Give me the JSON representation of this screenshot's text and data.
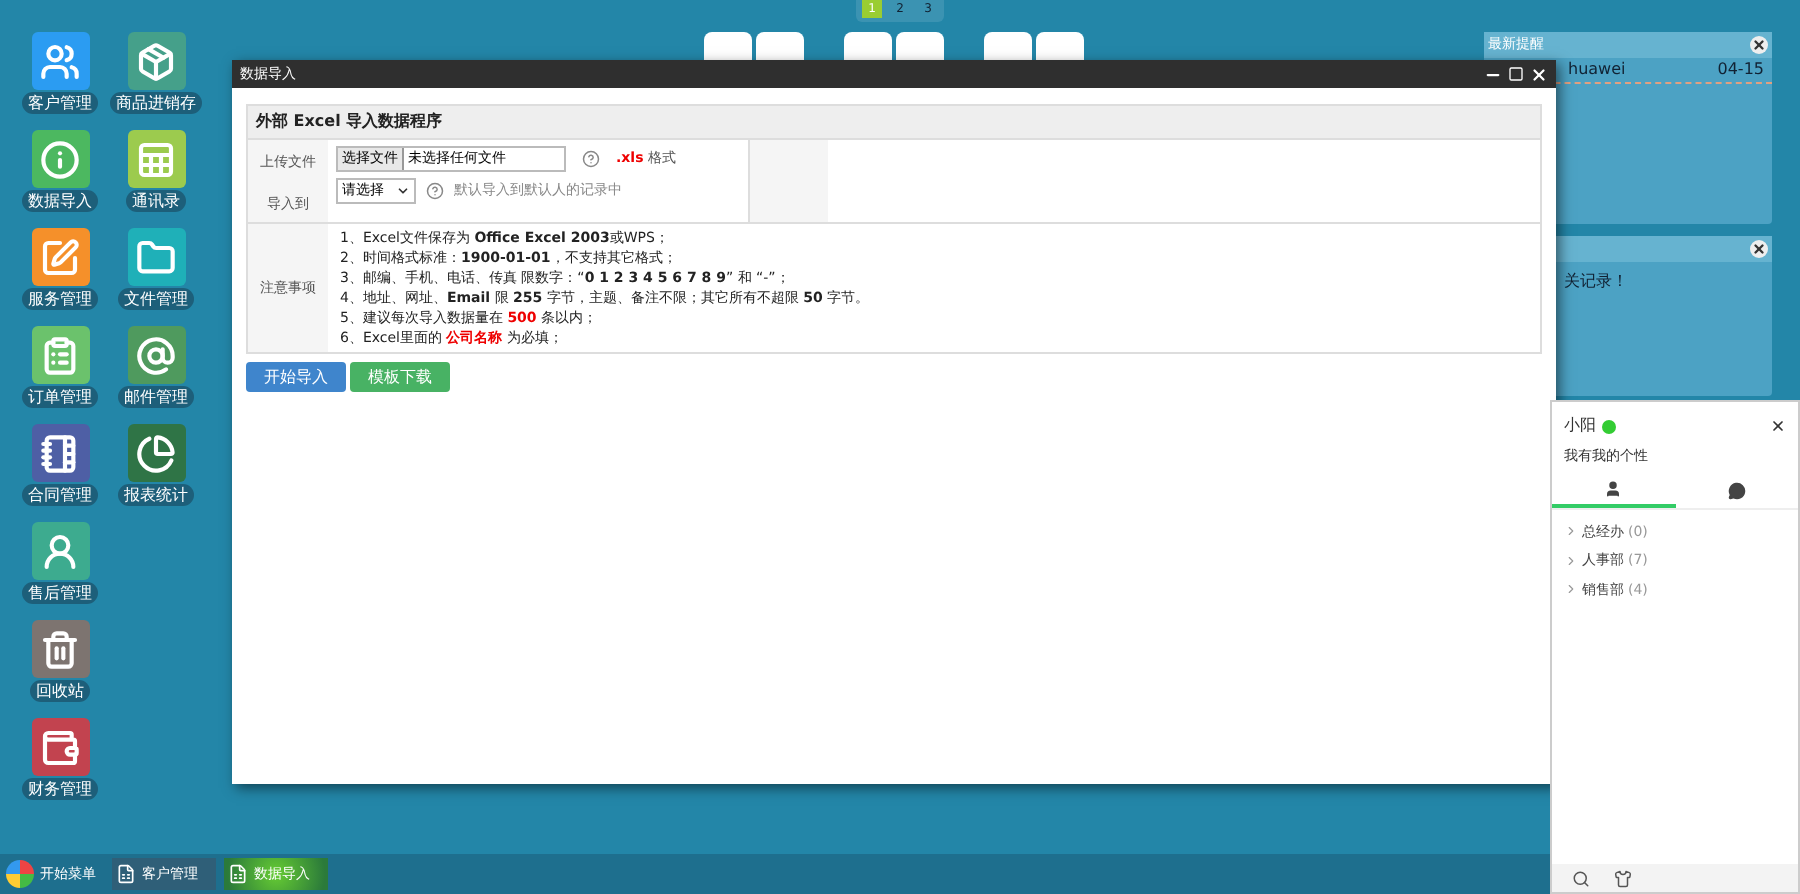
{
  "desktop_icons": [
    {
      "label": "客户管理"
    },
    {
      "label": "数据导入"
    },
    {
      "label": "服务管理"
    },
    {
      "label": "订单管理"
    },
    {
      "label": "合同管理"
    },
    {
      "label": "售后管理"
    },
    {
      "label": "回收站"
    },
    {
      "label": "财务管理"
    },
    {
      "label": "商品进销存"
    },
    {
      "label": "通讯录"
    },
    {
      "label": "文件管理"
    },
    {
      "label": "邮件管理"
    },
    {
      "label": "报表统计"
    }
  ],
  "pager": [
    {
      "label": "1",
      "selected": true
    },
    {
      "label": "2",
      "selected": false
    },
    {
      "label": "3",
      "selected": false
    }
  ],
  "reminder_panel": {
    "title": "最新提醒",
    "rows": [
      {
        "name": "huawei",
        "date": "04-15"
      }
    ]
  },
  "record_panel": {
    "message": "关记录！"
  },
  "dialog": {
    "title": "数据导入",
    "heading": "外部 Excel 导入数据程序",
    "upload": {
      "label": "上传文件",
      "button": "选择文件",
      "file": "未选择任何文件",
      "format_ext": ".xls",
      "format_text": "格式"
    },
    "target": {
      "label": "导入到",
      "select": "请选择",
      "hint": "默认导入到默认人的记录中"
    },
    "notes_label": "注意事项",
    "notes": [
      [
        {
          "kind": "plain",
          "text": "1、Excel文件保存为 "
        },
        {
          "kind": "bold",
          "text": "Office Excel 2003"
        },
        {
          "kind": "plain",
          "text": "或WPS；"
        }
      ],
      [
        {
          "kind": "plain",
          "text": "2、时间格式标准："
        },
        {
          "kind": "bold",
          "text": "1900-01-01"
        },
        {
          "kind": "plain",
          "text": "，不支持其它格式；"
        }
      ],
      [
        {
          "kind": "plain",
          "text": "3、邮编、手机、电话、传真 限数字：“"
        },
        {
          "kind": "bold",
          "text": "0 1 2 3 4 5 6 7 8 9"
        },
        {
          "kind": "plain",
          "text": "” 和 “-”；"
        }
      ],
      [
        {
          "kind": "plain",
          "text": "4、地址、网址、"
        },
        {
          "kind": "bold",
          "text": "Email"
        },
        {
          "kind": "plain",
          "text": " 限 "
        },
        {
          "kind": "bold",
          "text": "255"
        },
        {
          "kind": "plain",
          "text": " 字节，主题、备注不限；其它所有不超限 "
        },
        {
          "kind": "bold",
          "text": "50"
        },
        {
          "kind": "plain",
          "text": " 字节。"
        }
      ],
      [
        {
          "kind": "plain",
          "text": "5、建议每次导入数据量在 "
        },
        {
          "kind": "red",
          "text": "500"
        },
        {
          "kind": "plain",
          "text": " 条以内；"
        }
      ],
      [
        {
          "kind": "plain",
          "text": "6、Excel里面的 "
        },
        {
          "kind": "red",
          "text": "公司名称"
        },
        {
          "kind": "plain",
          "text": " 为必填；"
        }
      ]
    ],
    "buttons": [
      {
        "label": "开始导入",
        "kind": "primary"
      },
      {
        "label": "模板下载",
        "kind": "success"
      }
    ]
  },
  "chat": {
    "user": "小阳",
    "online": true,
    "signature": "我有我的个性",
    "tabs": [
      {
        "kind": "contacts",
        "selected": true
      },
      {
        "kind": "messages",
        "selected": false
      }
    ],
    "groups": [
      {
        "name": "总经办",
        "count": "(0)"
      },
      {
        "name": "人事部",
        "count": "(7)"
      },
      {
        "name": "销售部",
        "count": "(4)"
      }
    ]
  },
  "taskbar": {
    "start": "开始菜单",
    "items": [
      {
        "label": "客户管理",
        "selected": false
      },
      {
        "label": "数据导入",
        "selected": true
      }
    ]
  }
}
